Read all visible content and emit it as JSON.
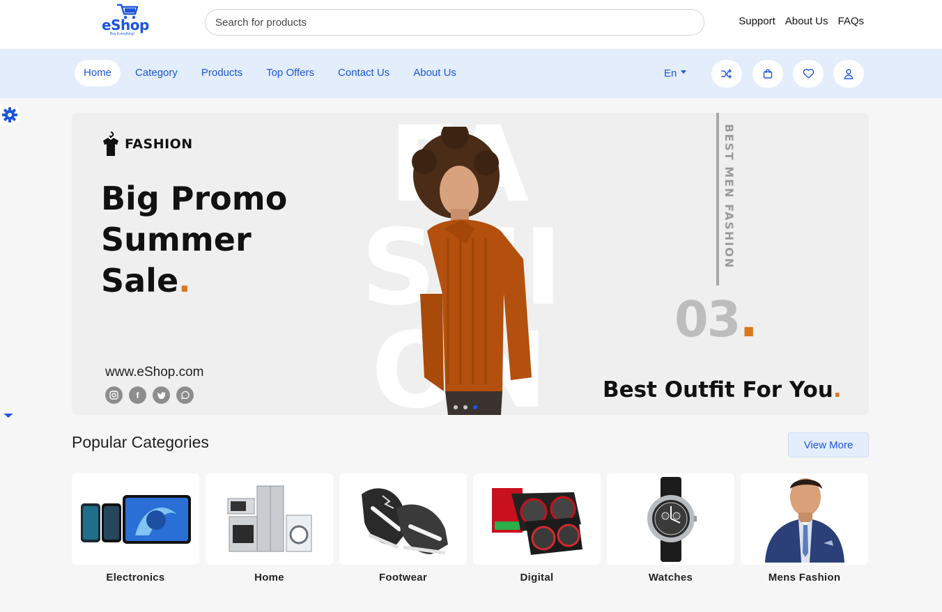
{
  "header": {
    "logo_text": "eShop",
    "logo_tagline": "Buy Everything!",
    "search_placeholder": "Search for products",
    "links": [
      "Support",
      "About Us",
      "FAQs"
    ]
  },
  "nav": {
    "items": [
      "Home",
      "Category",
      "Products",
      "Top Offers",
      "Contact Us",
      "About Us"
    ],
    "active": "Home",
    "language": "En",
    "icons": [
      "shuffle-icon",
      "bag-icon",
      "heart-icon",
      "user-icon"
    ]
  },
  "hero": {
    "brand": "FASHION",
    "headline_lines": [
      "Big Promo",
      "Summer",
      "Sale"
    ],
    "background_word": "FASHION",
    "vertical_text": "BEST MEN FASHION",
    "slide_number": "03",
    "tagline": "Best Outfit For You",
    "website": "www.eShop.com",
    "social_icons": [
      "instagram-icon",
      "facebook-icon",
      "twitter-icon",
      "whatsapp-icon"
    ],
    "active_slide": 3
  },
  "categories": {
    "title": "Popular Categories",
    "view_more": "View More",
    "items": [
      {
        "label": "Electronics"
      },
      {
        "label": "Home"
      },
      {
        "label": "Footwear"
      },
      {
        "label": "Digital"
      },
      {
        "label": "Watches"
      },
      {
        "label": "Mens Fashion"
      }
    ]
  },
  "colors": {
    "primary": "#1a56db",
    "nav_bg": "#e3edfc",
    "accent": "#d9771e"
  }
}
